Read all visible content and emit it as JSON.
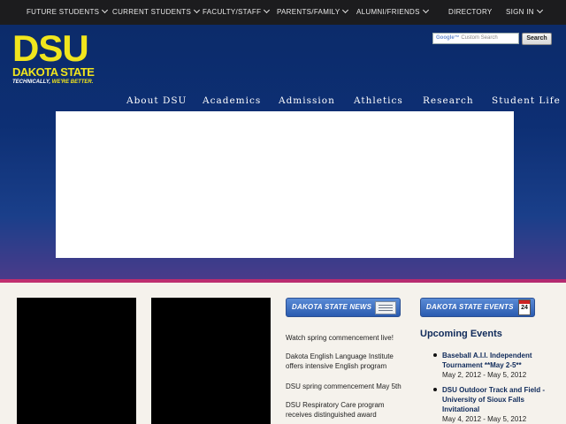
{
  "topbar": {
    "items": [
      {
        "label": "FUTURE STUDENTS",
        "has_dropdown": true
      },
      {
        "label": "CURRENT STUDENTS",
        "has_dropdown": true
      },
      {
        "label": "FACULTY/STAFF",
        "has_dropdown": true
      },
      {
        "label": "PARENTS/FAMILY",
        "has_dropdown": true
      },
      {
        "label": "ALUMNI/FRIENDS",
        "has_dropdown": true
      },
      {
        "label": "DIRECTORY",
        "has_dropdown": false
      },
      {
        "label": "SIGN IN",
        "has_dropdown": true
      }
    ]
  },
  "logo": {
    "line1": "DSU",
    "line2": "DAKOTA STATE",
    "tagline_a": "TECHNICALLY, ",
    "tagline_b": "WE'RE BETTER."
  },
  "search": {
    "placeholder_brand": "Google™",
    "placeholder_text": "Custom Search",
    "button_label": "Search"
  },
  "main_nav": [
    "About DSU",
    "Academics",
    "Admission",
    "Athletics",
    "Research",
    "Student Life"
  ],
  "news": {
    "header": "DAKOTA STATE NEWS",
    "items": [
      "Watch spring commencement live!",
      "Dakota English Language Institute offers intensive English program",
      "DSU spring commencement May 5th",
      "DSU Respiratory Care program receives distinguished award"
    ]
  },
  "events": {
    "header": "DAKOTA STATE EVENTS",
    "calendar_day": "24",
    "title": "Upcoming Events",
    "items": [
      {
        "title": "Baseball A.I.I. Independent Tournament **May 2-5**",
        "date": "May 2, 2012 - May 5, 2012"
      },
      {
        "title": "DSU Outdoor Track and Field - University of Sioux Falls Invitational",
        "date": "May 4, 2012 - May 5, 2012"
      }
    ]
  },
  "colors": {
    "topbar_bg": "#1c1c1e",
    "header_blue": "#0d2f74",
    "accent_yellow": "#f1e51d",
    "accent_pink": "#c12f6f",
    "page_bg": "#f5f2ec"
  }
}
